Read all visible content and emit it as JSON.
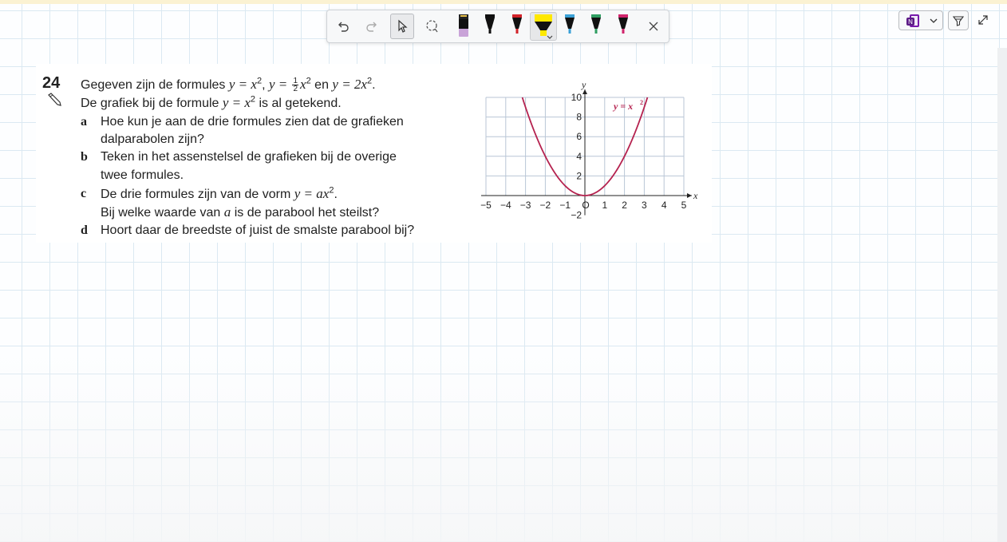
{
  "toolbar": {
    "tools": [
      {
        "name": "undo",
        "icon": "undo-icon"
      },
      {
        "name": "redo",
        "icon": "redo-icon"
      },
      {
        "name": "select",
        "icon": "select-arrow-icon",
        "active": true
      },
      {
        "name": "lasso",
        "icon": "lasso-icon"
      },
      {
        "name": "pen-lavender",
        "color": "#c9a3d8"
      },
      {
        "name": "pen-black",
        "color": "#111111"
      },
      {
        "name": "pen-red",
        "color": "#d2232a"
      },
      {
        "name": "highlighter-yellow",
        "color": "#ffe800",
        "active": true
      },
      {
        "name": "pen-blue",
        "color": "#3aa0d6"
      },
      {
        "name": "pen-green",
        "color": "#2f9e62"
      },
      {
        "name": "pen-magenta",
        "color": "#d0246c"
      },
      {
        "name": "close",
        "icon": "close-icon"
      }
    ]
  },
  "topbar": {
    "app_icon": "onenote-icon",
    "dropdown_icon": "chevron-down-icon",
    "filter_icon": "filter-icon",
    "expand_icon": "expand-icon"
  },
  "exercise": {
    "number": "24",
    "intro": {
      "text1": "Gegeven zijn de formules ",
      "f1": "y = x",
      "sep1": ", ",
      "f2a": "y = ",
      "half_num": "1",
      "half_den": "2",
      "f2b": "x",
      "sep2": " en ",
      "f3": "y = 2x",
      "end": ".",
      "exp": "2"
    },
    "line2": {
      "text": "De grafiek bij de formule ",
      "formula": "y = x",
      "exp": "2",
      "rest": " is al getekend."
    },
    "questions": {
      "a": {
        "label": "a",
        "line1": "Hoe kun je aan de drie formules zien dat de grafieken",
        "line2": "dalparabolen zijn?"
      },
      "b": {
        "label": "b",
        "line1": "Teken in het assenstelsel de grafieken bij de overige",
        "line2": "twee formules."
      },
      "c": {
        "label": "c",
        "line1_pre": "De drie formules zijn van de vorm ",
        "line1_formula": "y = ax",
        "exp": "2",
        "line1_end": ".",
        "line2_pre": "Bij welke waarde van ",
        "line2_var": "a",
        "line2_post": " is de parabool het steilst?"
      },
      "d": {
        "label": "d",
        "line1": "Hoort daar de breedste of juist de smalste parabool bij?"
      }
    }
  },
  "chart_data": {
    "type": "line",
    "series": [
      {
        "name": "y = x²",
        "color": "#b5224f",
        "function": "x^2",
        "x_from": -3.162,
        "x_to": 3.162
      }
    ],
    "series_label": "y = x",
    "series_label_exp": "2",
    "xlabel": "x",
    "ylabel": "y",
    "xlim": [
      -5,
      5
    ],
    "ylim": [
      -2,
      10
    ],
    "x_ticks": [
      "-5",
      "-4",
      "-3",
      "-2",
      "-1",
      "O",
      "1",
      "2",
      "3",
      "4",
      "5"
    ],
    "y_ticks": [
      "10",
      "8",
      "6",
      "4",
      "2",
      "-2"
    ],
    "grid": true
  }
}
